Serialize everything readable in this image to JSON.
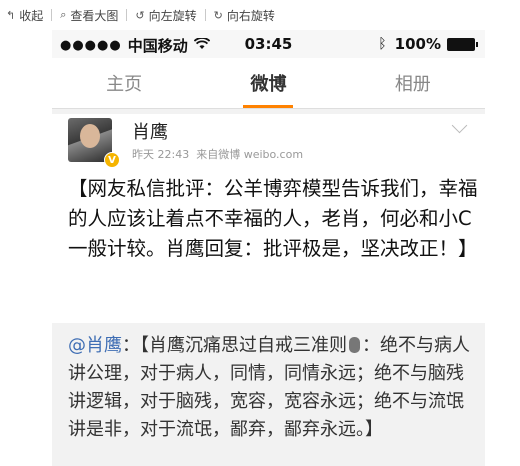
{
  "toolbar": {
    "collapse_label": "收起",
    "view_large_label": "查看大图",
    "rotate_left_label": "向左旋转",
    "rotate_right_label": "向右旋转"
  },
  "statusbar": {
    "signal": "●●●●●",
    "carrier": "中国移动",
    "time": "03:45",
    "battery_percent": "100%"
  },
  "tabs": [
    {
      "label": "主页",
      "active": false
    },
    {
      "label": "微博",
      "active": true
    },
    {
      "label": "相册",
      "active": false
    }
  ],
  "accent_color": "#ff8200",
  "post": {
    "author": "肖鹰",
    "verified_badge": "V",
    "time": "昨天 22:43",
    "source": "来自微博 weibo.com",
    "text": "【网友私信批评：公羊博弈模型告诉我们，幸福的人应该让着点不幸福的人，老肖，何必和小C一般计较。肖鹰回复：批评极是，坚决改正！】"
  },
  "repost": {
    "mention": "@肖鹰",
    "text_before_icon": "：【肖鹰沉痛思过自戒三准则",
    "text_after_icon": "：绝不与病人讲公理，对于病人，同情，同情永远；绝不与脑残讲逻辑，对于脑残，宽容，宽容永远；绝不与流氓讲是非，对于流氓，鄙弃，鄙弃永远。】"
  }
}
